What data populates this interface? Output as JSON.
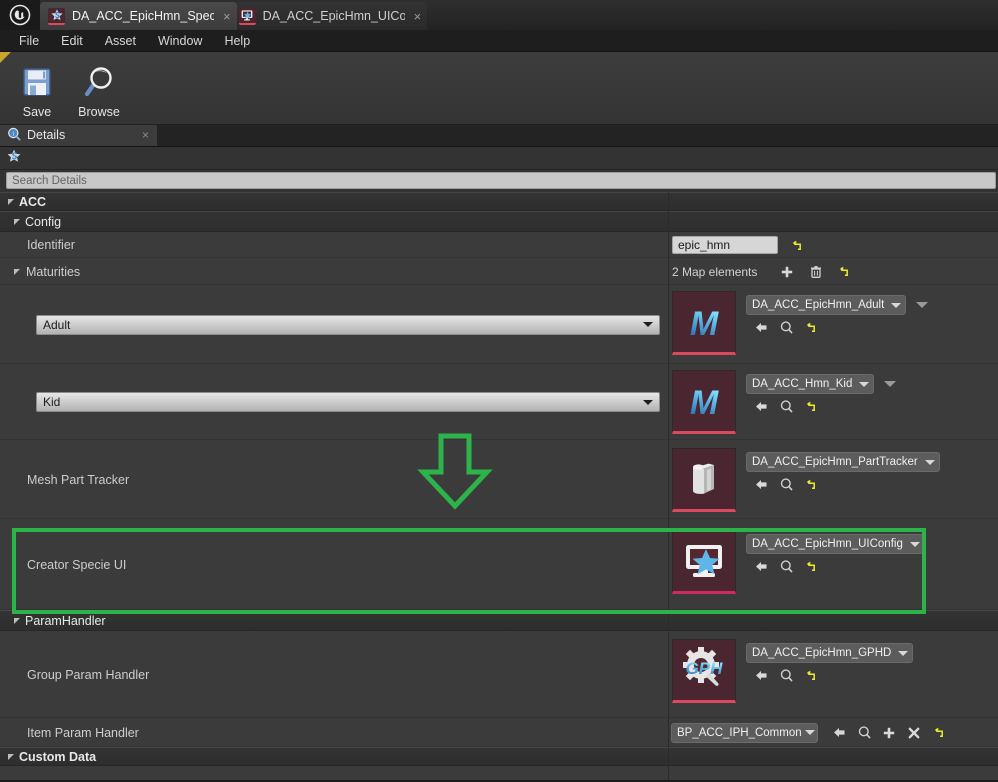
{
  "window": {
    "logo_glyph": "U",
    "tabs": [
      {
        "title": "DA_ACC_EpicHmn_Speci",
        "icon": "star-asset-icon",
        "active": true,
        "close_glyph": "×"
      },
      {
        "title": "DA_ACC_EpicHmn_UICon",
        "icon": "monitor-star-asset-icon",
        "active": false,
        "close_glyph": "×"
      }
    ]
  },
  "menubar": {
    "items": [
      "File",
      "Edit",
      "Asset",
      "Window",
      "Help"
    ]
  },
  "toolbar": {
    "buttons": [
      {
        "label": "Save",
        "icon": "floppy-disk-icon"
      },
      {
        "label": "Browse",
        "icon": "magnifier-icon"
      }
    ]
  },
  "details_panel": {
    "tab_label": "Details",
    "tab_icon": "details-info-icon",
    "tab_close_glyph": "×",
    "tool_icon": "star-filter-icon",
    "search": {
      "value": "",
      "placeholder": "Search Details"
    }
  },
  "tree": {
    "categories": {
      "acc": "ACC",
      "config": "Config",
      "paramhandler": "ParamHandler",
      "customdata": "Custom Data"
    },
    "identifier": {
      "label": "Identifier",
      "value": "epic_hmn",
      "reset_icon": "reset-arrow-icon"
    },
    "maturities": {
      "label": "Maturities",
      "count_text": "2 Map elements",
      "add_icon": "plus-icon",
      "delete_icon": "trash-icon",
      "reset_icon": "reset-arrow-icon",
      "entries": [
        {
          "key": "Adult",
          "asset": "DA_ACC_EpicHmn_Adult",
          "thumb": "M-letter-asset-icon",
          "icons": [
            "browse-back-icon",
            "search-asset-icon",
            "reset-arrow-icon"
          ],
          "has_extra_chevron": true
        },
        {
          "key": "Kid",
          "asset": "DA_ACC_Hmn_Kid",
          "thumb": "M-letter-asset-icon",
          "icons": [
            "browse-back-icon",
            "search-asset-icon",
            "reset-arrow-icon"
          ],
          "has_extra_chevron": true
        }
      ]
    },
    "mesh_part_tracker": {
      "label": "Mesh Part Tracker",
      "asset": "DA_ACC_EpicHmn_PartTracker",
      "thumb": "cylinder-asset-icon",
      "icons": [
        "browse-back-icon",
        "search-asset-icon",
        "reset-arrow-icon"
      ]
    },
    "creator_specie_ui": {
      "label": "Creator Specie UI",
      "asset": "DA_ACC_EpicHmn_UIConfig",
      "thumb": "monitor-star-asset-icon",
      "icons": [
        "browse-back-icon",
        "search-asset-icon",
        "reset-arrow-icon"
      ]
    },
    "group_param_handler": {
      "label": "Group Param Handler",
      "asset": "DA_ACC_EpicHmn_GPHD",
      "thumb": "GPH-gear-asset-icon",
      "icons": [
        "browse-back-icon",
        "search-asset-icon",
        "reset-arrow-icon"
      ]
    },
    "item_param_handler": {
      "label": "Item Param Handler",
      "asset": "BP_ACC_IPH_Common",
      "icons": [
        "browse-back-icon",
        "search-asset-icon",
        "plus-icon",
        "clear-x-icon",
        "reset-arrow-icon"
      ]
    }
  },
  "annotations": {
    "highlight_color": "#2cb34a",
    "arrow": {
      "name": "down-arrow-annotation",
      "direction": "down"
    },
    "rect": {
      "name": "creator-specie-ui-highlight"
    }
  }
}
